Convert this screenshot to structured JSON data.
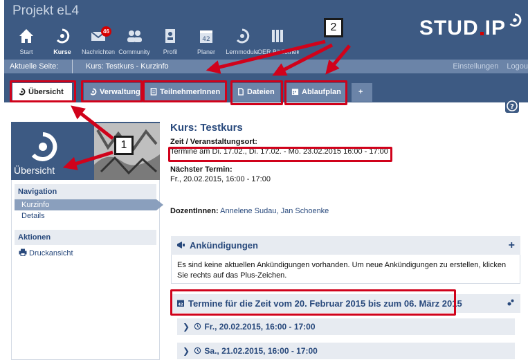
{
  "header": {
    "project_title": "Projekt eL4",
    "nav": [
      {
        "label": "Start",
        "icon": "home-icon"
      },
      {
        "label": "Kurse",
        "icon": "courses-icon"
      },
      {
        "label": "Nachrichten",
        "icon": "mail-icon",
        "badge": "46"
      },
      {
        "label": "Community",
        "icon": "community-icon"
      },
      {
        "label": "Profil",
        "icon": "profile-icon"
      },
      {
        "label": "Planer",
        "icon": "calendar-icon"
      },
      {
        "label": "Lernmodule",
        "icon": "learning-module-icon"
      },
      {
        "label": "OER Bibliothek",
        "icon": "library-icon"
      }
    ],
    "logo_left": "STUD",
    "logo_right": "IP"
  },
  "breadcrumb": {
    "label": "Aktuelle Seite:",
    "path": "Kurs: Testkurs - Kurzinfo",
    "settings": "Einstellungen",
    "logout": "Logou"
  },
  "tabs": [
    {
      "label": "Übersicht",
      "active": true
    },
    {
      "label": "Verwaltung"
    },
    {
      "label": "TeilnehmerInnen"
    },
    {
      "label": "Dateien"
    },
    {
      "label": "Ablaufplan"
    },
    {
      "label": "+"
    }
  ],
  "sidebar": {
    "title": "Übersicht",
    "nav_heading": "Navigation",
    "nav_items": [
      "Kurzinfo",
      "Details"
    ],
    "actions_heading": "Aktionen",
    "print": "Druckansicht"
  },
  "content": {
    "title": "Kurs: Testkurs",
    "time_label": "Zeit / Veranstaltungsort:",
    "time_value": "Termine am Di. 17.02., Di. 17.02. - Mo. 23.02.2015 16:00 - 17:00",
    "next_label": "Nächster Termin:",
    "next_value": "Fr., 20.02.2015, 16:00 - 17:00",
    "lecturers_label": "DozentInnen:",
    "lecturers": "Annelene Sudau, Jan Schoenke",
    "announcements_title": "Ankündigungen",
    "announcements_text": "Es sind keine aktuellen Ankündigungen vorhanden. Um neue Ankündigungen zu erstellen, klicken Sie rechts auf das Plus-Zeichen.",
    "dates_title": "Termine für die Zeit vom 20. Februar 2015 bis zum 06. März 2015",
    "appointments": [
      "Fr., 20.02.2015, 16:00 - 17:00",
      "Sa., 21.02.2015, 16:00 - 17:00"
    ]
  },
  "callouts": [
    "1",
    "2"
  ],
  "colors": {
    "header": "#3d5a83",
    "tab": "#6b84a8",
    "highlight": "#d0021b",
    "link": "#28497c"
  }
}
